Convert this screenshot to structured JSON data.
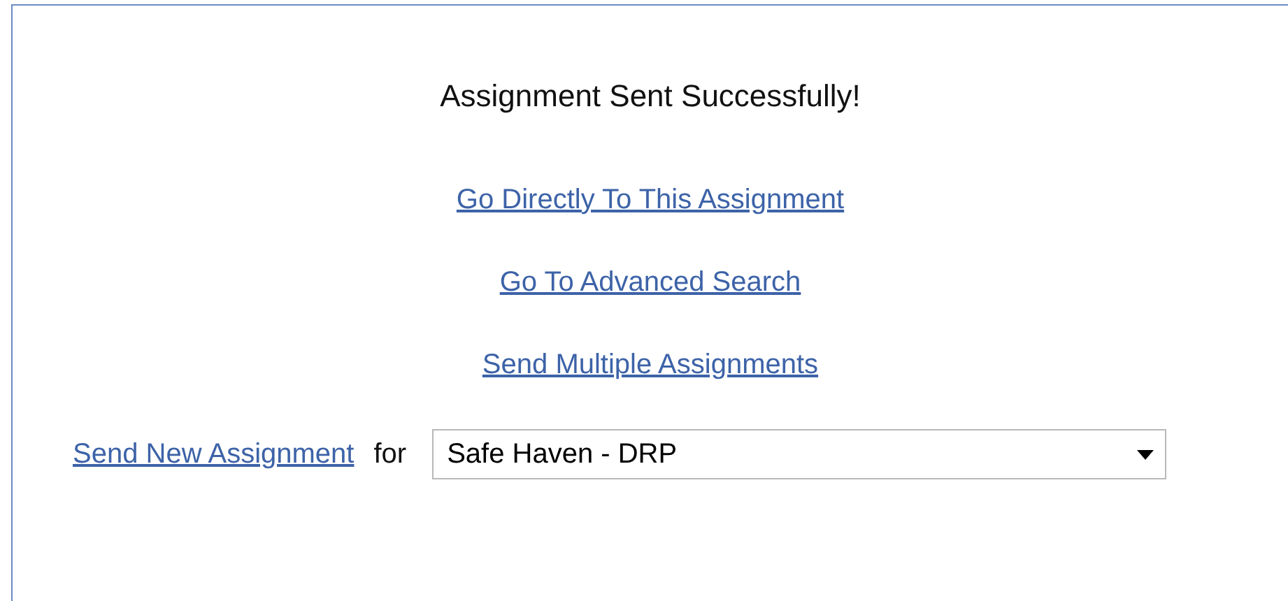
{
  "title": "Assignment Sent Successfully!",
  "links": [
    "Go Directly To This Assignment",
    "Go To Advanced Search",
    "Send Multiple Assignments"
  ],
  "send_row": {
    "link": "Send New Assignment",
    "for_label": "for",
    "dropdown": {
      "value": "Safe Haven - DRP"
    }
  }
}
